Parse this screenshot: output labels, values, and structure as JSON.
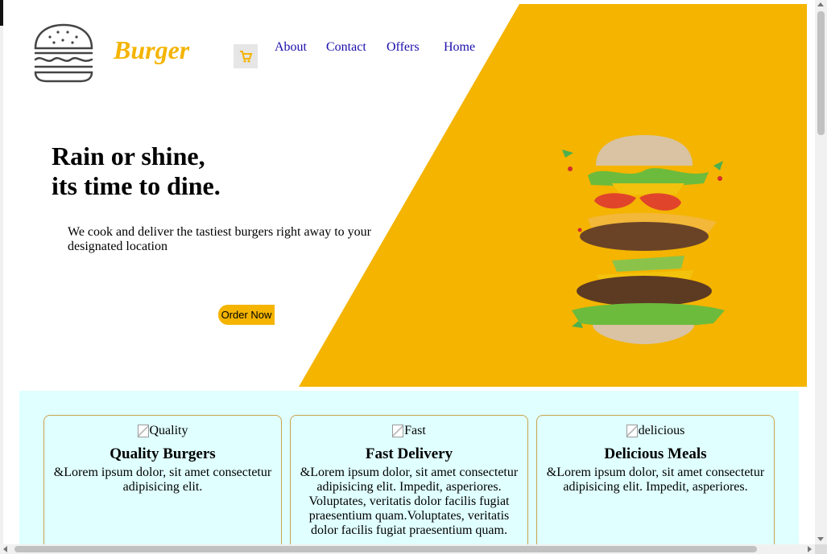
{
  "brand": {
    "name": "Burger",
    "accent_color": "#f4b400"
  },
  "header": {
    "cart_icon": "cart-icon"
  },
  "nav": [
    {
      "label": "About"
    },
    {
      "label": "Contact"
    },
    {
      "label": "Offers"
    },
    {
      "label": "Home"
    }
  ],
  "hero": {
    "headline_line1": "Rain or shine,",
    "headline_line2": "its time to dine.",
    "tagline": "We cook and deliver the tastiest burgers right away to your designated location",
    "cta_label": "Order Now",
    "background_color": "#f4b400"
  },
  "features": {
    "background_color": "#e0ffff",
    "cards": [
      {
        "image_alt": "Quality",
        "title": "Quality Burgers",
        "text": "&Lorem ipsum dolor, sit amet consectetur adipisicing elit."
      },
      {
        "image_alt": "Fast",
        "title": "Fast Delivery",
        "text": "&Lorem ipsum dolor, sit amet consectetur adipisicing elit. Impedit, asperiores. Voluptates, veritatis dolor facilis fugiat praesentium quam.Voluptates, veritatis dolor facilis fugiat praesentium quam."
      },
      {
        "image_alt": "delicious",
        "title": "Delicious Meals",
        "text": "&Lorem ipsum dolor, sit amet consectetur adipisicing elit. Impedit, asperiores."
      }
    ]
  }
}
